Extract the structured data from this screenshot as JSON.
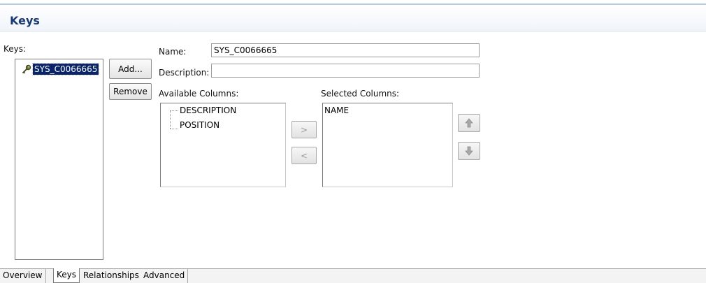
{
  "header": {
    "title": "Keys"
  },
  "keys_panel": {
    "label": "Keys:",
    "items": [
      {
        "name": "SYS_C0066665",
        "icon": "key-icon",
        "selected": true
      }
    ],
    "add_label": "Add...",
    "remove_label": "Remove"
  },
  "form": {
    "name_label": "Name:",
    "name_value": "SYS_C0066665",
    "description_label": "Description:",
    "description_value": ""
  },
  "available": {
    "label": "Available Columns:",
    "items": [
      "DESCRIPTION",
      "POSITION"
    ]
  },
  "selected": {
    "label": "Selected Columns:",
    "items": [
      "NAME"
    ]
  },
  "transfer": {
    "add_label": ">",
    "remove_label": "<"
  },
  "order": {
    "up_icon": "arrow-up-icon",
    "down_icon": "arrow-down-icon"
  },
  "tabs": [
    {
      "label": "Overview",
      "active": false
    },
    {
      "label": "Keys",
      "active": true
    },
    {
      "label": "Relationships",
      "active": false
    },
    {
      "label": "Advanced",
      "active": false
    }
  ],
  "colors": {
    "title": "#1a3a73",
    "selection": "#0a246a"
  }
}
